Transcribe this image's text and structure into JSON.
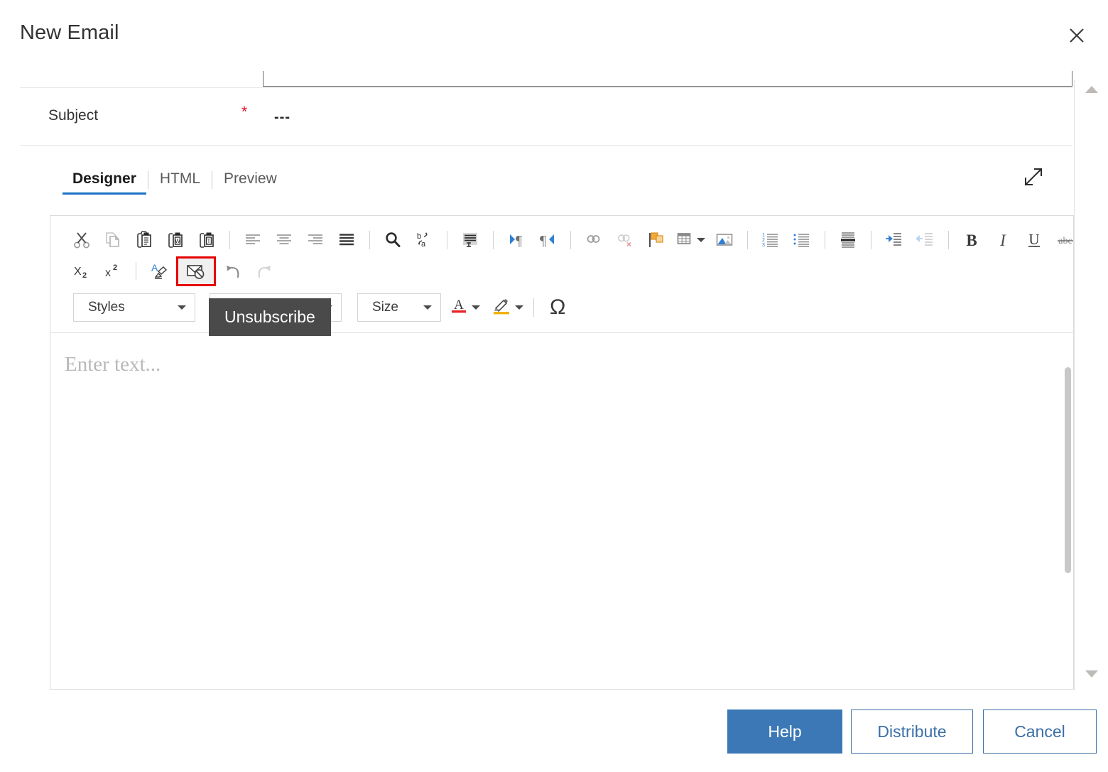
{
  "dialog": {
    "title": "New Email",
    "close_icon": "close-icon"
  },
  "form": {
    "subject_label": "Subject",
    "required_marker": "*",
    "subject_value": "---"
  },
  "tabs": [
    {
      "label": "Designer",
      "active": true
    },
    {
      "label": "HTML",
      "active": false
    },
    {
      "label": "Preview",
      "active": false
    }
  ],
  "expand_icon": "expand-diagonal-icon",
  "toolbar": {
    "row1": [
      {
        "name": "cut-icon",
        "label": "Cut"
      },
      {
        "name": "copy-icon",
        "label": "Copy"
      },
      {
        "name": "paste-icon",
        "label": "Paste"
      },
      {
        "name": "paste-from-word-icon",
        "label": "Paste from Word"
      },
      {
        "name": "paste-as-text-icon",
        "label": "Paste as plain text"
      },
      {
        "name": "separator",
        "label": ""
      },
      {
        "name": "align-left-icon",
        "label": "Align Left"
      },
      {
        "name": "align-center-icon",
        "label": "Align Center"
      },
      {
        "name": "align-right-icon",
        "label": "Align Right"
      },
      {
        "name": "align-justify-icon",
        "label": "Justify"
      },
      {
        "name": "separator",
        "label": ""
      },
      {
        "name": "find-icon",
        "label": "Find"
      },
      {
        "name": "replace-icon",
        "label": "Replace"
      },
      {
        "name": "separator",
        "label": ""
      },
      {
        "name": "select-all-icon",
        "label": "Select All"
      },
      {
        "name": "separator",
        "label": ""
      },
      {
        "name": "ltr-icon",
        "label": "Left to Right"
      },
      {
        "name": "rtl-icon",
        "label": "Right to Left"
      },
      {
        "name": "separator",
        "label": ""
      },
      {
        "name": "link-icon",
        "label": "Insert Link"
      },
      {
        "name": "unlink-icon",
        "label": "Remove Link"
      },
      {
        "name": "anchor-icon",
        "label": "Insert Anchor"
      },
      {
        "name": "table-icon",
        "label": "Insert Table"
      },
      {
        "name": "image-icon",
        "label": "Insert Image"
      },
      {
        "name": "separator",
        "label": ""
      },
      {
        "name": "numbered-list-icon",
        "label": "Numbered List"
      },
      {
        "name": "bulleted-list-icon",
        "label": "Bulleted List"
      },
      {
        "name": "separator",
        "label": ""
      },
      {
        "name": "horizontal-rule-icon",
        "label": "Horizontal Rule"
      },
      {
        "name": "separator",
        "label": ""
      },
      {
        "name": "indent-icon",
        "label": "Indent"
      },
      {
        "name": "outdent-icon",
        "label": "Outdent"
      },
      {
        "name": "separator",
        "label": ""
      },
      {
        "name": "bold-icon",
        "label": "Bold"
      },
      {
        "name": "italic-icon",
        "label": "Italic"
      },
      {
        "name": "underline-icon",
        "label": "Underline"
      },
      {
        "name": "strikethrough-icon",
        "label": "Strikethrough"
      }
    ],
    "row2": [
      {
        "name": "subscript-icon",
        "label": "Subscript"
      },
      {
        "name": "superscript-icon",
        "label": "Superscript"
      },
      {
        "name": "separator",
        "label": ""
      },
      {
        "name": "clear-formatting-icon",
        "label": "Clear Formatting"
      },
      {
        "name": "unsubscribe-icon",
        "label": "Unsubscribe"
      },
      {
        "name": "undo-icon",
        "label": "Undo"
      },
      {
        "name": "redo-icon",
        "label": "Redo"
      }
    ],
    "styles_dropdown": "Styles",
    "font_dropdown": "Font",
    "size_dropdown": "Size",
    "font_color_icon": "font-color-icon",
    "highlight_color_icon": "text-highlight-icon",
    "symbol_icon": "omega-symbol-icon",
    "symbol_glyph": "Ω"
  },
  "tooltip": {
    "text": "Unsubscribe"
  },
  "editor": {
    "placeholder": "Enter text..."
  },
  "footer": {
    "help": "Help",
    "distribute": "Distribute",
    "cancel": "Cancel"
  },
  "colors": {
    "accent_blue": "#3b78b5",
    "tab_underline": "#1a73c8",
    "highlight_red": "#e60000",
    "required_red": "#e81123",
    "tooltip_bg": "#4a4a4a"
  }
}
